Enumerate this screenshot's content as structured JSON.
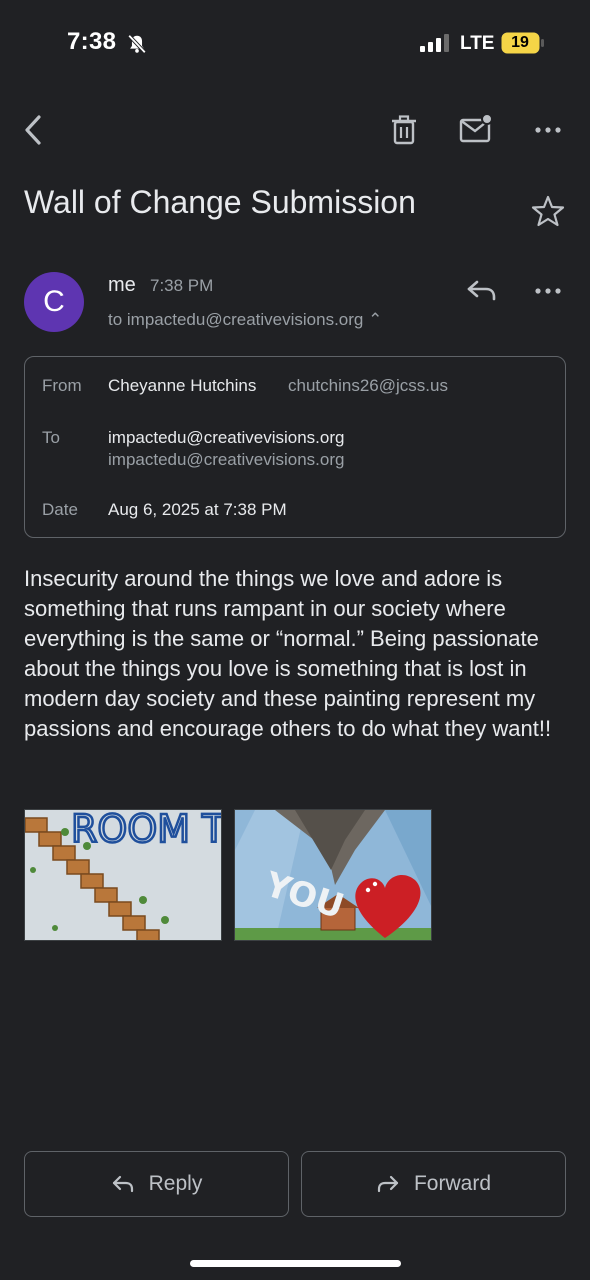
{
  "status_bar": {
    "time": "7:38",
    "network": "LTE",
    "battery": "19"
  },
  "email": {
    "subject": "Wall of Change Submission",
    "sender_initial": "C",
    "sender_label": "me",
    "sent_time": "7:38 PM",
    "to_summary": "to impactedu@creativevisions.org ⌃",
    "details": {
      "from_label": "From",
      "from_name": "Cheyanne Hutchins",
      "from_email": "chutchins26@jcss.us",
      "to_label": "To",
      "to_name": "impactedu@creativevisions.org",
      "to_email": "impactedu@creativevisions.org",
      "date_label": "Date",
      "date_value": "Aug 6, 2025 at 7:38 PM"
    },
    "body": "Insecurity around the things we love and adore is something that runs rampant in our society where everything is the same or “normal.” Being passionate about the things you love is something that is lost in modern day society and these painting represent my passions and encourage others to do what they want!!",
    "attachments": {
      "painting1_text": "ROOM THE UNDER STAI",
      "painting2_text": "YOU"
    }
  },
  "actions": {
    "reply": "Reply",
    "forward": "Forward"
  },
  "icons": {
    "back": "chevron-left-icon",
    "delete": "trash-icon",
    "mark_unread": "mail-unread-icon",
    "more": "more-horizontal-icon",
    "star": "star-outline-icon",
    "reply": "reply-icon"
  },
  "colors": {
    "background": "#202124",
    "avatar": "#5e35b1",
    "border": "#5f6368",
    "battery": "#f5d547"
  }
}
